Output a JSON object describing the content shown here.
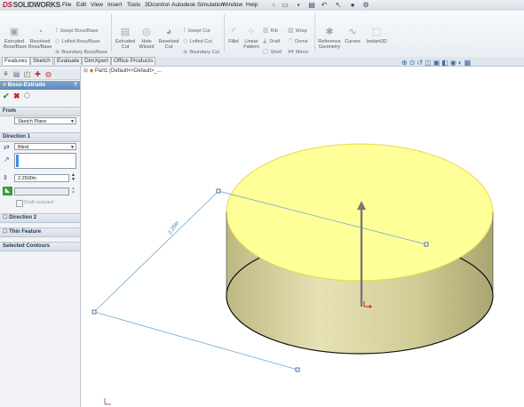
{
  "app": {
    "logo_ds": "DS",
    "logo": "SOLIDWORKS",
    "menus": [
      "File",
      "Edit",
      "View",
      "Insert",
      "Tools",
      "3Dcontrol",
      "Autodesk Simulation",
      "Window",
      "Help"
    ]
  },
  "quick_access": [
    "new-icon",
    "open-icon",
    "save-icon",
    "print-icon",
    "undo-icon",
    "select-icon",
    "rebuild-icon",
    "options-icon"
  ],
  "command_manager": {
    "big_tools": [
      {
        "label": "Extruded\nBoss/Base",
        "icon": "extrude-boss-icon"
      },
      {
        "label": "Revolved\nBoss/Base",
        "icon": "revolve-boss-icon"
      },
      {
        "label": "Extruded\nCut",
        "icon": "extrude-cut-icon"
      },
      {
        "label": "Hole\nWizard",
        "icon": "hole-wizard-icon"
      },
      {
        "label": "Revolved\nCut",
        "icon": "revolve-cut-icon"
      },
      {
        "label": "Fillet",
        "icon": "fillet-icon"
      },
      {
        "label": "Linear\nPattern",
        "icon": "linear-pattern-icon"
      },
      {
        "label": "Reference\nGeometry",
        "icon": "reference-geometry-icon"
      },
      {
        "label": "Curves",
        "icon": "curves-icon"
      },
      {
        "label": "Instant3D",
        "icon": "instant3d-icon"
      }
    ],
    "small_tools": [
      {
        "label": "Swept Boss/Base"
      },
      {
        "label": "Lofted Boss/Base"
      },
      {
        "label": "Boundary Boss/Base"
      },
      {
        "label": "Swept Cut"
      },
      {
        "label": "Lofted Cut"
      },
      {
        "label": "Boundary Cut"
      },
      {
        "label": "Rib"
      },
      {
        "label": "Draft"
      },
      {
        "label": "Shell"
      },
      {
        "label": "Wrap"
      },
      {
        "label": "Dome"
      },
      {
        "label": "Mirror"
      }
    ]
  },
  "tabs": [
    "Features",
    "Sketch",
    "Evaluate",
    "DimXpert",
    "Office Products"
  ],
  "property_manager": {
    "title": "Boss-Extrude",
    "help": "?",
    "from": {
      "header": "From",
      "value": "Sketch Plane"
    },
    "direction1": {
      "header": "Direction 1",
      "end_condition": "Blind",
      "depth": "2.2500in",
      "draft_outward": "Draft outward"
    },
    "direction2": {
      "header": "Direction 2"
    },
    "thin_feature": {
      "header": "Thin Feature"
    },
    "selected_contours": {
      "header": "Selected Contours"
    }
  },
  "feature_tree": {
    "root": "Part1  (Default<<Default>_..."
  },
  "dimension_label": "2.25in",
  "colors": {
    "accent_blue": "#3d6aa6",
    "preview_yellow": "#ffff99",
    "cylinder_side": "#c9c48d",
    "title_blue": "#5d89b8"
  }
}
